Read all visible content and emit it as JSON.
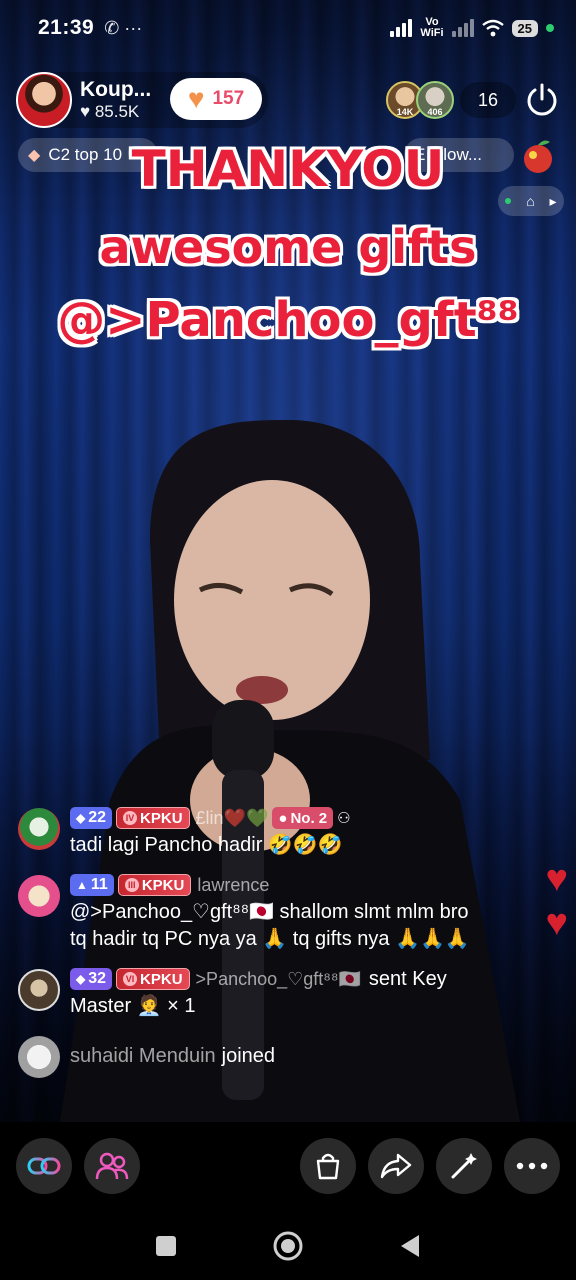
{
  "status_bar": {
    "time": "21:39",
    "left_icons": "✆ ···",
    "network": "Vo\nWiFi",
    "battery": "25"
  },
  "host": {
    "name": "Koup...",
    "likes": "85.5K",
    "follow_count": "157"
  },
  "viewers": {
    "avatar_1_badge": "14K",
    "avatar_2_badge": "406",
    "count": "16"
  },
  "tags": {
    "left": "C2 top 10",
    "right": "E Glow..."
  },
  "caption": {
    "line1": "THANKYOU",
    "line2": "awesome gifts",
    "line3": "@>Panchoo_gft⁸⁸"
  },
  "chat": {
    "messages": [
      {
        "level": "22",
        "club": "KPKU",
        "username": "£lin❤️💚",
        "rank": "No. 2",
        "text": "tadi lagi Pancho hadir 🤣🤣🤣"
      },
      {
        "level": "11",
        "club": "KPKU",
        "username": "lawrence",
        "text_line1": "@>Panchoo_♡gft⁸⁸🇯🇵 shallom slmt mlm bro",
        "text_line2": "tq hadir tq PC nya ya 🙏 tq gifts nya 🙏🙏🙏"
      },
      {
        "level": "32",
        "club": "KPKU",
        "username": ">Panchoo_♡gft⁸⁸🇯🇵",
        "action": "sent Key",
        "text_line2": "Master 🧑‍💼 × 1"
      }
    ],
    "joined": {
      "username": "suhaidi Menduin",
      "action": "joined"
    }
  },
  "colors": {
    "caption_red": "#e9213a",
    "heart_red": "#d8212f",
    "club_red": "#c5272f",
    "level_blue": "#5b6cf0",
    "level_purple": "#7a5bea"
  },
  "toolbar": {
    "icons": [
      "link-icon",
      "people-icon",
      "shop-icon",
      "share-icon",
      "magic-wand-icon",
      "more-icon"
    ]
  },
  "system_nav": {
    "icons": [
      "recents-icon",
      "home-icon",
      "back-icon"
    ]
  }
}
